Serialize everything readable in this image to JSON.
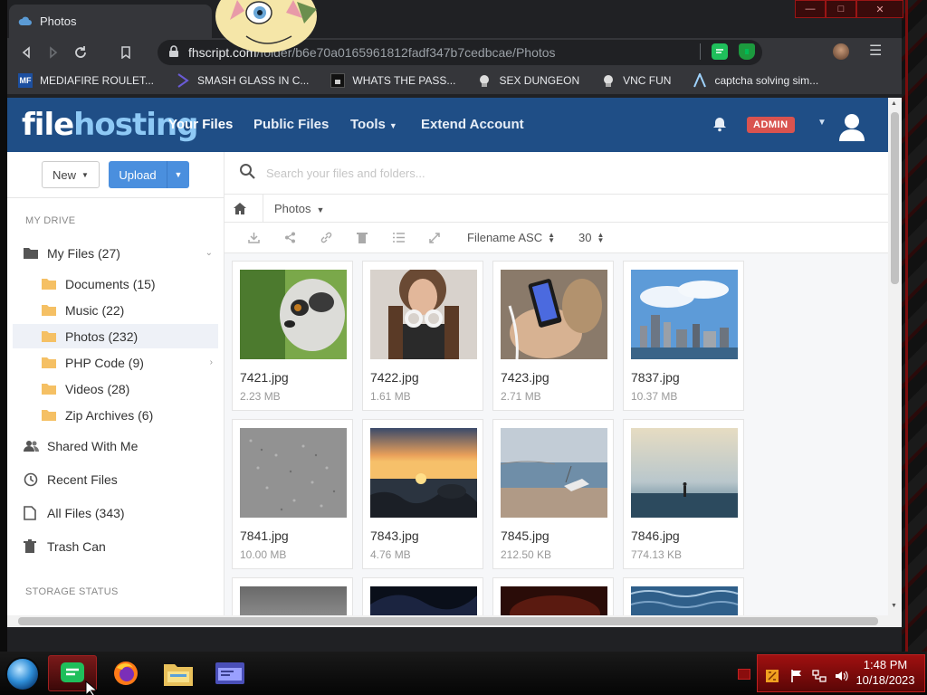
{
  "browser": {
    "tab_title": "Photos",
    "url_host": "fhscript.com",
    "url_path": "/folder/b6e70a0165961812fadf347b7cedbcae/Photos",
    "bookmarks": [
      {
        "label": "MEDIAFIRE ROULET...",
        "icon": "mediafire-icon"
      },
      {
        "label": "SMASH GLASS IN C...",
        "icon": "glass-icon"
      },
      {
        "label": "WHATS THE PASS...",
        "icon": "lock-icon"
      },
      {
        "label": "SEX DUNGEON",
        "icon": "dungeon-icon"
      },
      {
        "label": "VNC FUN",
        "icon": "vnc-icon"
      },
      {
        "label": "captcha solving sim...",
        "icon": "captcha-icon"
      }
    ]
  },
  "site": {
    "logo_a": "file",
    "logo_b": "hosting",
    "nav": [
      "Your Files",
      "Public Files",
      "Tools",
      "Extend Account"
    ],
    "admin_badge": "ADMIN",
    "brand_color": "#1f4e86"
  },
  "sidebar": {
    "new_label": "New",
    "upload_label": "Upload",
    "section_drive": "MY DRIVE",
    "my_files": "My Files (27)",
    "folders": [
      "Documents (15)",
      "Music (22)",
      "Photos (232)",
      "PHP Code (9)",
      "Videos (28)",
      "Zip Archives (6)"
    ],
    "selected_folder": "Photos (232)",
    "shared": "Shared With Me",
    "recent": "Recent Files",
    "all_files": "All Files (343)",
    "trash": "Trash Can",
    "section_storage": "STORAGE STATUS"
  },
  "content": {
    "search_placeholder": "Search your files and folders...",
    "breadcrumb": "Photos",
    "sort": "Filename ASC",
    "per_page": "30",
    "files": [
      {
        "name": "7421.jpg",
        "size": "2.23 MB"
      },
      {
        "name": "7422.jpg",
        "size": "1.61 MB"
      },
      {
        "name": "7423.jpg",
        "size": "2.71 MB"
      },
      {
        "name": "7837.jpg",
        "size": "10.37 MB"
      },
      {
        "name": "7841.jpg",
        "size": "10.00 MB"
      },
      {
        "name": "7843.jpg",
        "size": "4.76 MB"
      },
      {
        "name": "7845.jpg",
        "size": "212.50 KB"
      },
      {
        "name": "7846.jpg",
        "size": "774.13 KB"
      },
      {
        "name": "",
        "size": ""
      },
      {
        "name": "",
        "size": ""
      },
      {
        "name": "",
        "size": ""
      },
      {
        "name": "",
        "size": ""
      }
    ]
  },
  "taskbar": {
    "time": "1:48 PM",
    "date": "10/18/2023"
  }
}
